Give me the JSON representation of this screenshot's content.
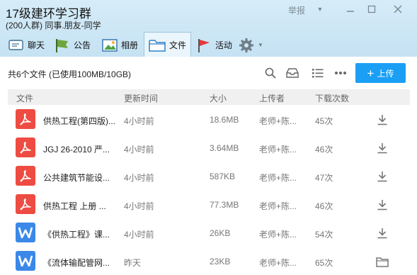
{
  "window": {
    "title": "17级建环学习群",
    "subtitle": "(200人群) 同事.朋友-同学",
    "report_label": "举报"
  },
  "tabs": [
    {
      "label": "聊天",
      "icon": "chat-icon"
    },
    {
      "label": "公告",
      "icon": "announcement-flag-icon"
    },
    {
      "label": "相册",
      "icon": "photo-album-icon"
    },
    {
      "label": "文件",
      "icon": "folder-icon",
      "active": true
    },
    {
      "label": "活动",
      "icon": "activity-flag-icon"
    }
  ],
  "toolbar": {
    "summary": "共6个文件 (已使用100MB/10GB)",
    "upload_label": "上传"
  },
  "table": {
    "columns": [
      "文件",
      "更新时间",
      "大小",
      "上传者",
      "下载次数"
    ],
    "rows": [
      {
        "type": "pdf",
        "name": "供热工程(第四版)...",
        "time": "4小时前",
        "size": "18.6MB",
        "uploader": "老师+陈...",
        "downloads": "45次",
        "action": "download"
      },
      {
        "type": "pdf",
        "name": "JGJ 26-2010 严...",
        "time": "4小时前",
        "size": "3.64MB",
        "uploader": "老师+陈...",
        "downloads": "46次",
        "action": "download"
      },
      {
        "type": "pdf",
        "name": "公共建筑节能设...",
        "time": "4小时前",
        "size": "587KB",
        "uploader": "老师+陈...",
        "downloads": "47次",
        "action": "download"
      },
      {
        "type": "pdf",
        "name": "供热工程  上册 ...",
        "time": "4小时前",
        "size": "77.3MB",
        "uploader": "老师+陈...",
        "downloads": "46次",
        "action": "download"
      },
      {
        "type": "doc",
        "name": "《供热工程》课...",
        "time": "4小时前",
        "size": "26KB",
        "uploader": "老师+陈...",
        "downloads": "54次",
        "action": "download"
      },
      {
        "type": "doc",
        "name": "《流体输配管网...",
        "time": "昨天",
        "size": "23KB",
        "uploader": "老师+陈...",
        "downloads": "65次",
        "action": "open-folder"
      }
    ]
  },
  "colors": {
    "header_bg": "#cfe8f6",
    "accent": "#1a9ff5",
    "pdf_icon": "#ee4b42",
    "doc_icon": "#3b88e8"
  }
}
